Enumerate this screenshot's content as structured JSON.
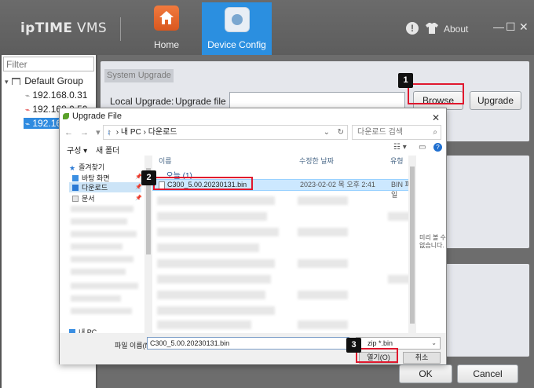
{
  "app": {
    "logo": {
      "bold": "ipTIME",
      "light": " VMS"
    },
    "nav": {
      "home": "Home",
      "device_config": "Device Config"
    },
    "about": "About",
    "window_controls": {
      "minimize": "—",
      "maximize": "☐",
      "close": "✕"
    }
  },
  "sidebar": {
    "filter_placeholder": "Filter",
    "root": "Default Group",
    "items": [
      {
        "label": "192.168.0.31"
      },
      {
        "label": "192.168.0.50"
      },
      {
        "label": "192.16"
      }
    ]
  },
  "upgrade": {
    "group_title": "System Upgrade",
    "local_label": "Local Upgrade:",
    "file_label": "Upgrade file",
    "file_value": "",
    "browse": "Browse",
    "upgrade_button": "Upgrade"
  },
  "footer": {
    "ok": "OK",
    "cancel": "Cancel"
  },
  "dialog": {
    "title": "Upgrade File",
    "close": "✕",
    "nav_arrows": "← → ▾ ↑",
    "address": {
      "pc": "내 PC",
      "sep": "›",
      "folder": "다운로드"
    },
    "search_placeholder": "다운로드 검색",
    "toolbar": {
      "organize": "구성 ▾",
      "new_folder": "새 폴더"
    },
    "nav_pane": {
      "quick_access": "즐겨찾기",
      "desktop": "바탕 화면",
      "downloads": "다운로드",
      "documents": "문서",
      "this_pc": "내 PC"
    },
    "columns": {
      "name": "이름",
      "date": "수정한 날짜",
      "type": "유형"
    },
    "group_today": "오늘 (1)",
    "file": {
      "name": "C300_5.00.20230131.bin",
      "date": "2023-02-02 목 오후 2:41",
      "type": "BIN 파일"
    },
    "preview_text": "미리 볼 수 없습니다.",
    "filename_label": "파일 이름(N):",
    "filename_value": "C300_5.00.20230131.bin",
    "filetype_value": "zip *.bin",
    "open": "열기(O)",
    "cancel": "취소"
  },
  "annotations": {
    "step1": "1",
    "step2": "2",
    "step3": "3"
  },
  "colors": {
    "accent": "#2b8fe0",
    "highlight": "#e0182e",
    "home_icon": "#e5652c"
  }
}
